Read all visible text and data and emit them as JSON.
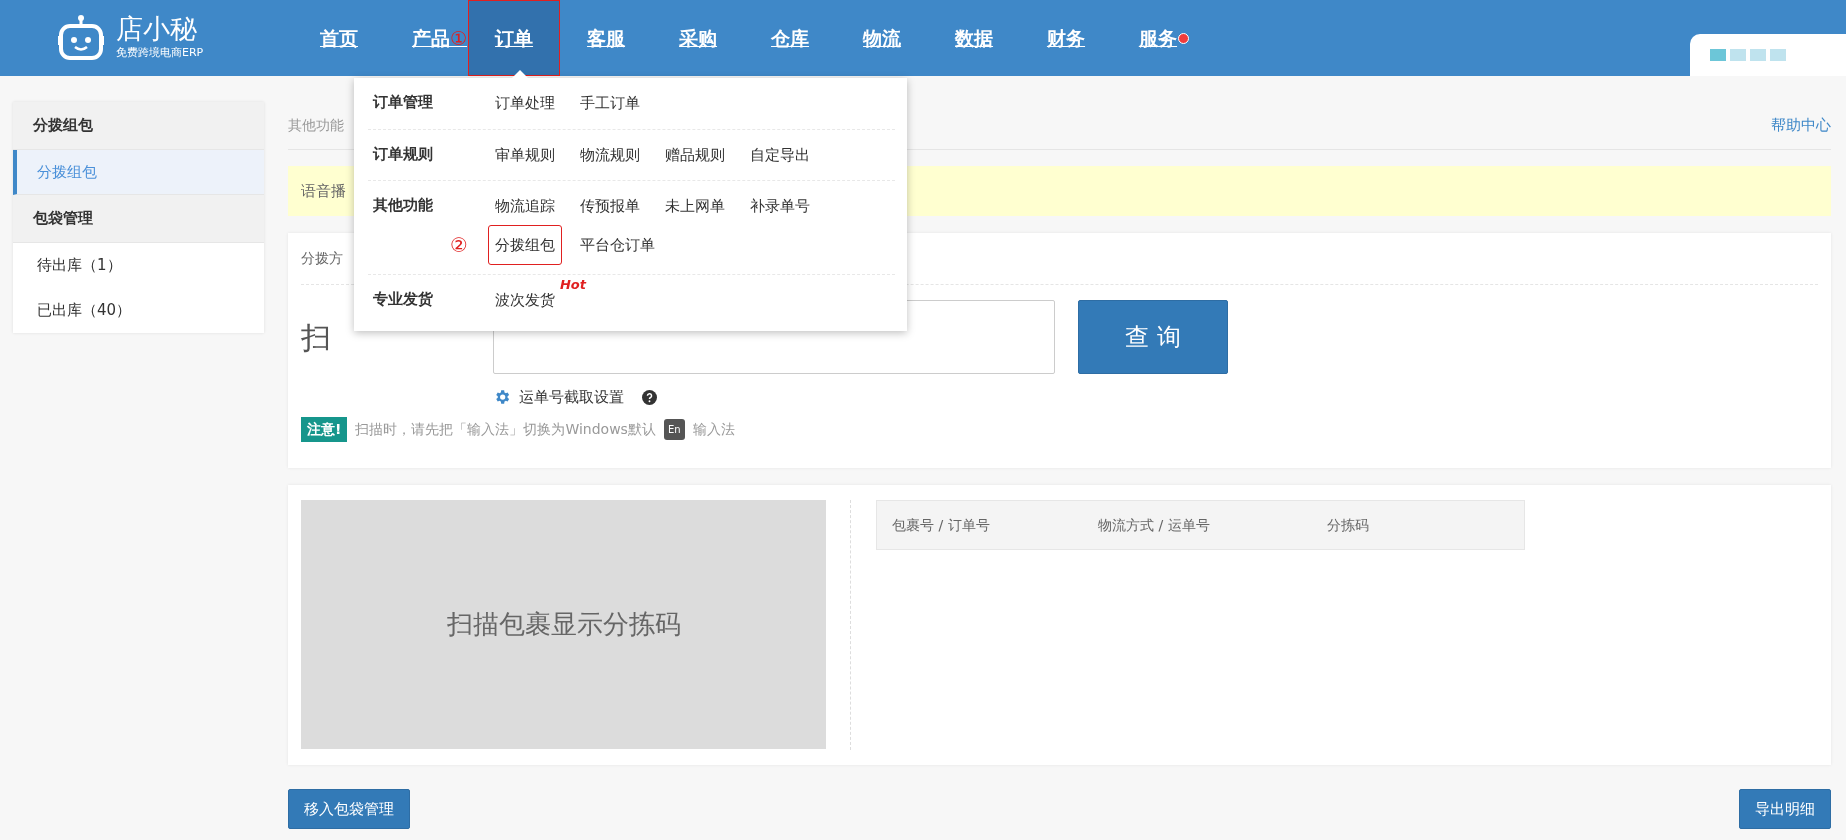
{
  "header": {
    "logo": {
      "name": "店小秘",
      "tagline": "免费跨境电商ERP"
    },
    "nav": [
      {
        "label": "首页",
        "selected": false,
        "highlighted": false,
        "dot": false
      },
      {
        "label": "产品",
        "selected": false,
        "highlighted": false,
        "dot": false,
        "marker": "①"
      },
      {
        "label": "订单",
        "selected": true,
        "highlighted": true,
        "dot": false
      },
      {
        "label": "客服",
        "selected": false,
        "highlighted": false,
        "dot": false
      },
      {
        "label": "采购",
        "selected": false,
        "highlighted": false,
        "dot": false
      },
      {
        "label": "仓库",
        "selected": false,
        "highlighted": false,
        "dot": false
      },
      {
        "label": "物流",
        "selected": false,
        "highlighted": false,
        "dot": false
      },
      {
        "label": "数据",
        "selected": false,
        "highlighted": false,
        "dot": false
      },
      {
        "label": "财务",
        "selected": false,
        "highlighted": false,
        "dot": false
      },
      {
        "label": "服务",
        "selected": false,
        "highlighted": false,
        "dot": true
      }
    ]
  },
  "dropdown": {
    "groups": [
      {
        "label": "订单管理",
        "rows": [
          [
            {
              "label": "订单处理",
              "highlighted": false
            },
            {
              "label": "手工订单",
              "highlighted": false
            }
          ]
        ]
      },
      {
        "label": "订单规则",
        "rows": [
          [
            {
              "label": "审单规则",
              "highlighted": false
            },
            {
              "label": "物流规则",
              "highlighted": false
            },
            {
              "label": "赠品规则",
              "highlighted": false
            },
            {
              "label": "自定导出",
              "highlighted": false
            }
          ]
        ]
      },
      {
        "label": "其他功能",
        "rows": [
          [
            {
              "label": "物流追踪",
              "highlighted": false
            },
            {
              "label": "传预报单",
              "highlighted": false
            },
            {
              "label": "未上网单",
              "highlighted": false
            },
            {
              "label": "补录单号",
              "highlighted": false
            }
          ],
          [
            {
              "label": "分拨组包",
              "highlighted": true,
              "marker": "②"
            },
            {
              "label": "平台仓订单",
              "highlighted": false
            }
          ]
        ]
      },
      {
        "label": "专业发货",
        "rows": [
          [
            {
              "label": "波次发货",
              "highlighted": false,
              "tag": "Hot"
            }
          ]
        ]
      }
    ]
  },
  "sidebar": {
    "groups": [
      {
        "title": "分拨组包",
        "items": [
          {
            "label": "分拨组包",
            "selected": true
          }
        ]
      },
      {
        "title": "包袋管理",
        "items": [
          {
            "label": "待出库（1）",
            "selected": false
          },
          {
            "label": "已出库（40）",
            "selected": false
          }
        ]
      }
    ]
  },
  "main": {
    "breadcrumb": "其他功能",
    "help_link": "帮助中心",
    "notice": "语音播",
    "scan_card": {
      "section_label": "分拨方",
      "scan_label": "扫",
      "query_button": "查 询",
      "settings_link": "运单号截取设置",
      "tip": {
        "badge": "注意!",
        "text": "扫描时，请先把「输入法」切换为Windows默认",
        "key": "En",
        "suffix": "输入法"
      }
    },
    "result_card": {
      "preview_text": "扫描包裹显示分拣码",
      "columns": [
        "包裹号 / 订单号",
        "物流方式 / 运单号",
        "分拣码"
      ]
    },
    "buttons": {
      "left": "移入包袋管理",
      "right": "导出明细"
    }
  }
}
